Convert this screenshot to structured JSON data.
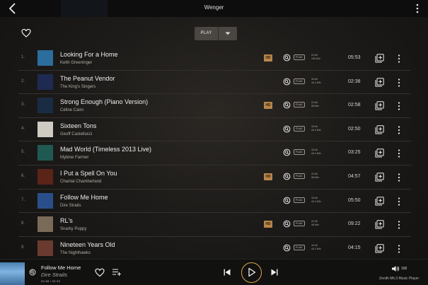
{
  "header": {
    "title": "Wenger"
  },
  "actions": {
    "play_label": "PLAY"
  },
  "tracks": [
    {
      "num": "1.",
      "title": "Looking For a Home",
      "artist": "Keith Greeninger",
      "hd": "HD",
      "format": "FLAC",
      "rate1": "24 bit",
      "rate2": "192 kHz",
      "duration": "05:53",
      "cover": "#2b6d9c"
    },
    {
      "num": "2.",
      "title": "The Peanut Vendor",
      "artist": "The King's Singers",
      "hd": "",
      "format": "FLAC",
      "rate1": "16 bit",
      "rate2": "44.1 kHz",
      "duration": "02:38",
      "cover": "#1e2a52"
    },
    {
      "num": "3.",
      "title": "Strong Enough (Piano Version)",
      "artist": "Céline Cairo",
      "hd": "HD",
      "format": "FLAC",
      "rate1": "24 bit",
      "rate2": "96 kHz",
      "duration": "02:58",
      "cover": "#1a2c44"
    },
    {
      "num": "4.",
      "title": "Sixteen Tons",
      "artist": "Geoff Castellucci",
      "hd": "",
      "format": "FLAC",
      "rate1": "16 bit",
      "rate2": "44.1 kHz",
      "duration": "02:50",
      "cover": "#cfcac2"
    },
    {
      "num": "5.",
      "title": "Mad World (Timeless 2013 Live)",
      "artist": "Mylène Farmer",
      "hd": "",
      "format": "FLAC",
      "rate1": "16 bit",
      "rate2": "44.1 kHz",
      "duration": "03:25",
      "cover": "#1f5a52"
    },
    {
      "num": "6.",
      "title": "I Put a Spell On You",
      "artist": "Chantal Chamberland",
      "hd": "HD",
      "format": "FLAC",
      "rate1": "24 bit",
      "rate2": "96 kHz",
      "duration": "04:57",
      "cover": "#5a2418"
    },
    {
      "num": "7.",
      "title": "Follow Me Home",
      "artist": "Dire Straits",
      "hd": "",
      "format": "FLAC",
      "rate1": "16 bit",
      "rate2": "44.1 kHz",
      "duration": "05:50",
      "cover": "#2a4e8a"
    },
    {
      "num": "8.",
      "title": "RL's",
      "artist": "Snarky Puppy",
      "hd": "HD",
      "format": "FLAC",
      "rate1": "24 bit",
      "rate2": "96 kHz",
      "duration": "09:22",
      "cover": "#7a6a58"
    },
    {
      "num": "9.",
      "title": "Nineteen Years Old",
      "artist": "The Nighthawks",
      "hd": "",
      "format": "FLAC",
      "rate1": "16 bit",
      "rate2": "44.1 kHz",
      "duration": "04:15",
      "cover": "#6a3a30"
    }
  ],
  "player": {
    "title": "Follow Me Home",
    "artist": "Dire Straits",
    "time": "00:58 / 05:50",
    "volume": "100",
    "device": "Zenith Mk.3 Music Player"
  },
  "colors": {
    "accent": "#d7a54e",
    "hd_badge": "#b8864a"
  },
  "icons": {
    "back": "chevron-left-icon",
    "more": "more-vertical-icon",
    "favorite": "heart-icon",
    "dropdown": "chevron-down-icon",
    "zoom": "zoom-icon",
    "add": "add-to-playlist-icon",
    "queue": "queue-icon",
    "prev": "skip-previous-icon",
    "play": "play-icon",
    "next": "skip-next-icon",
    "volume": "volume-icon"
  }
}
